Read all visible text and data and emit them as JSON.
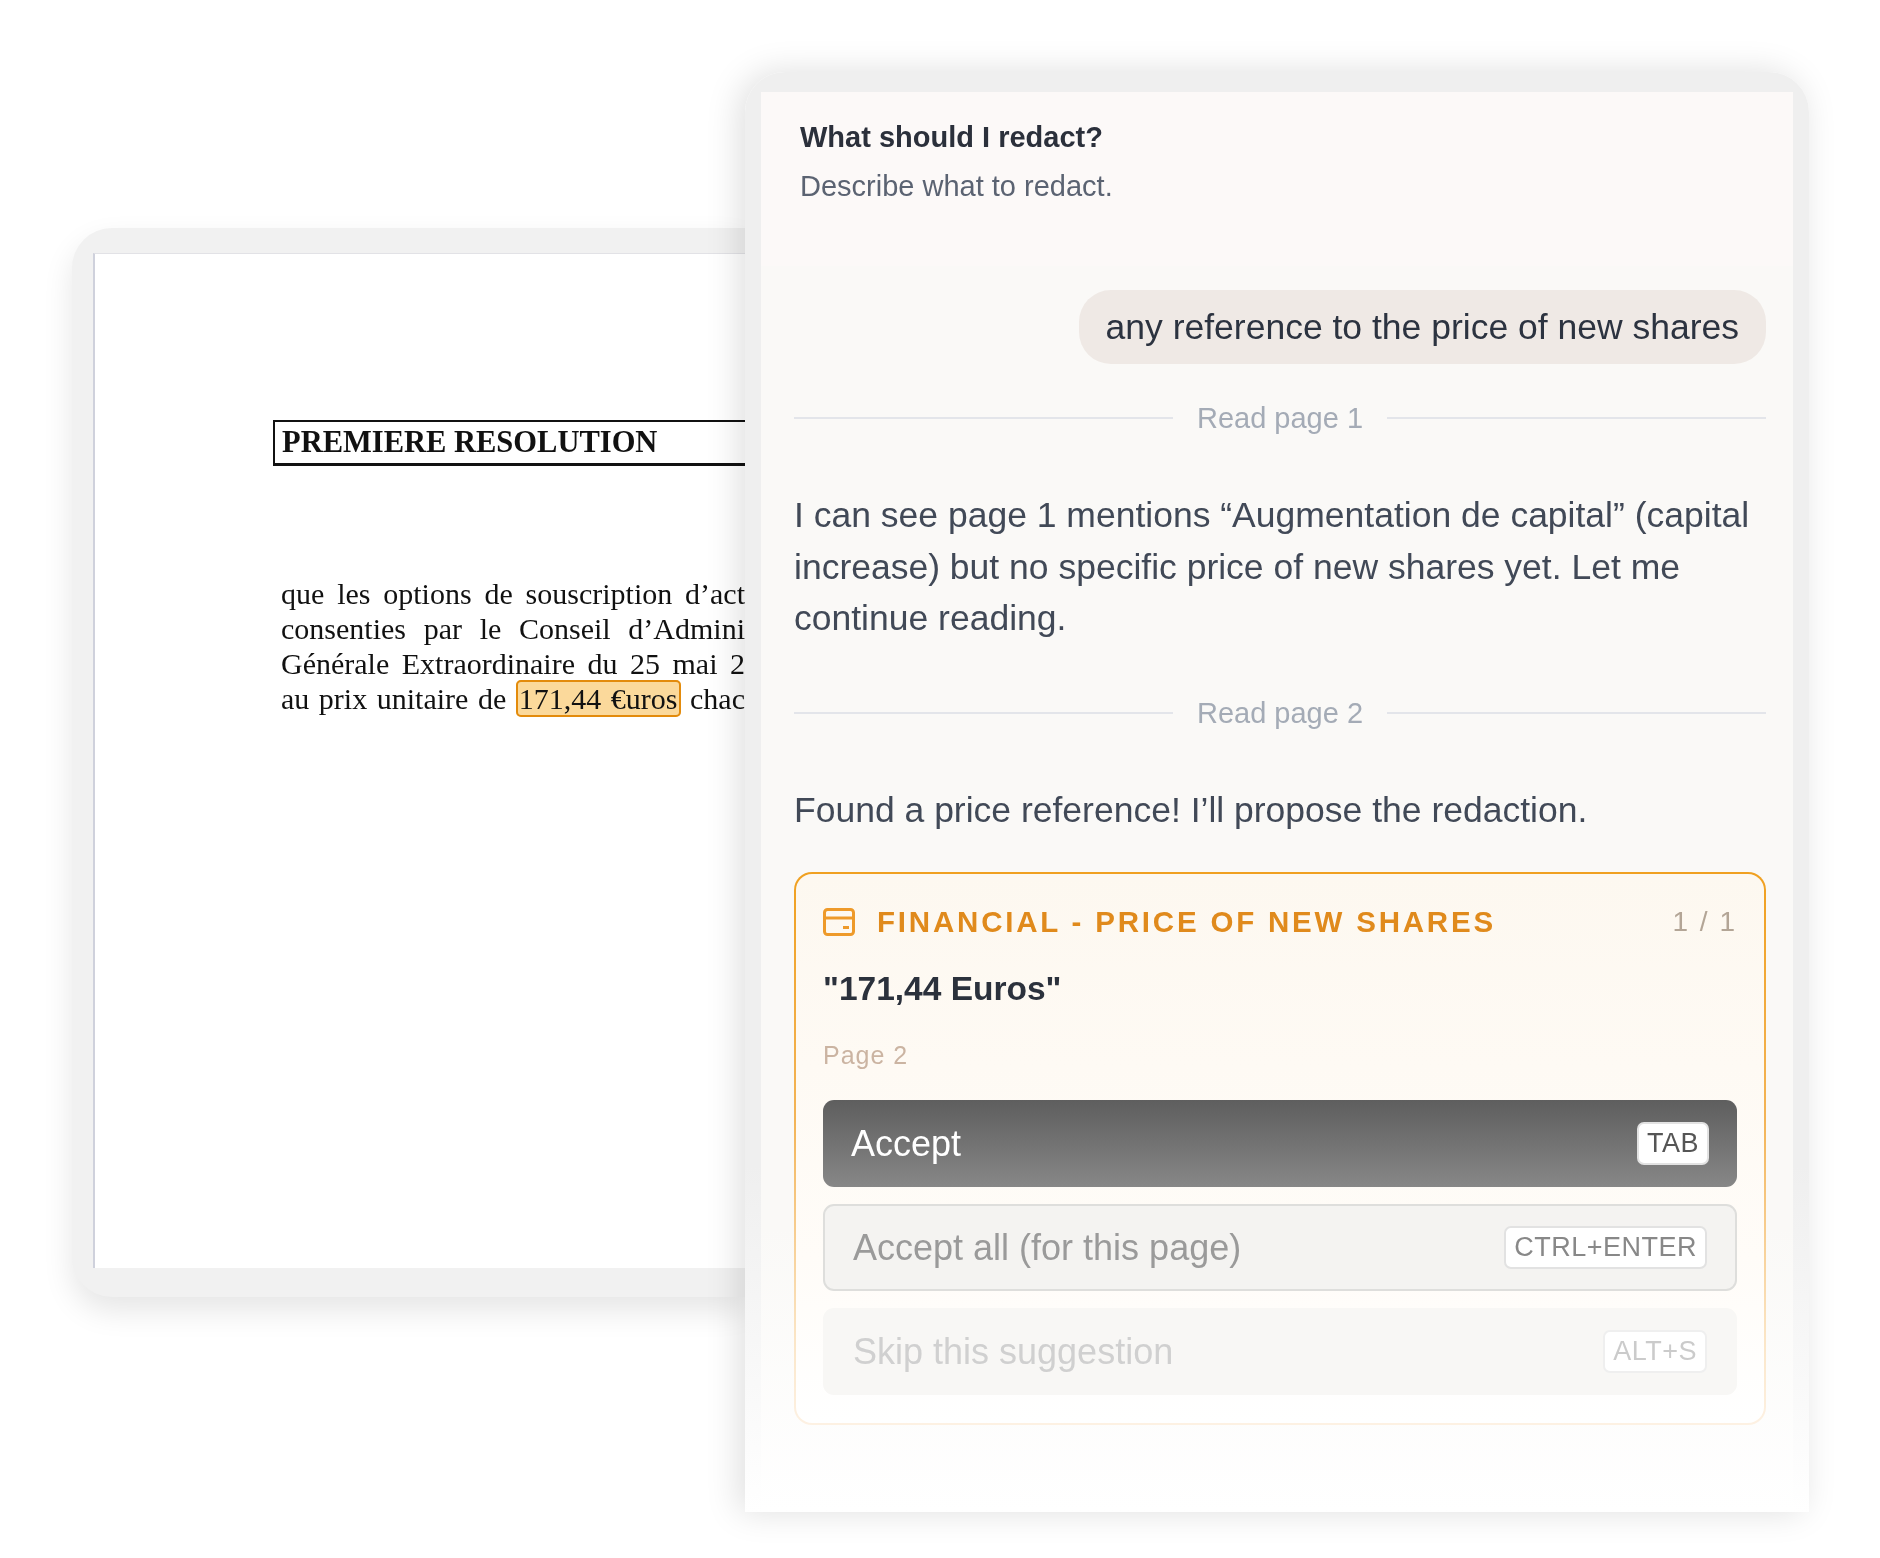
{
  "document": {
    "heading": "PREMIERE RESOLUTION",
    "lines": [
      {
        "segments": [
          {
            "text": "que les options de souscription d’act",
            "highlighted": false
          }
        ]
      },
      {
        "segments": [
          {
            "text": "consenties par le Conseil d’Admini",
            "highlighted": false
          }
        ]
      },
      {
        "segments": [
          {
            "text": "Générale Extraordinaire du 25 mai 2",
            "highlighted": false
          }
        ]
      },
      {
        "segments": [
          {
            "text": "au prix unitaire de",
            "highlighted": false
          },
          {
            "text": "171,44 €uros",
            "highlighted": true
          },
          {
            "text": "chac",
            "highlighted": false
          }
        ]
      }
    ]
  },
  "panel": {
    "title": "What should I redact?",
    "subtitle": "Describe what to redact.",
    "messages": [
      {
        "kind": "user",
        "text": "any reference to the price of new shares"
      },
      {
        "kind": "status",
        "text": "Read page 1"
      },
      {
        "kind": "assistant",
        "text": "I can see page 1 mentions “Augmentation de capital” (capital increase) but no specific price of new shares yet. Let me continue reading."
      },
      {
        "kind": "status",
        "text": "Read page 2"
      },
      {
        "kind": "assistant",
        "text": "Found a price reference! I’ll propose the redaction."
      }
    ],
    "suggestion": {
      "category": "FINANCIAL - PRICE OF NEW SHARES",
      "counter": "1 / 1",
      "quote": "\"171,44 Euros\"",
      "page": "Page 2",
      "actions": [
        {
          "label": "Accept",
          "shortcut": "TAB",
          "kind": "primary"
        },
        {
          "label": "Accept all (for this page)",
          "shortcut": "CTRL+ENTER",
          "kind": "secondary"
        },
        {
          "label": "Skip this suggestion",
          "shortcut": "ALT+S",
          "kind": "muted"
        }
      ]
    }
  }
}
